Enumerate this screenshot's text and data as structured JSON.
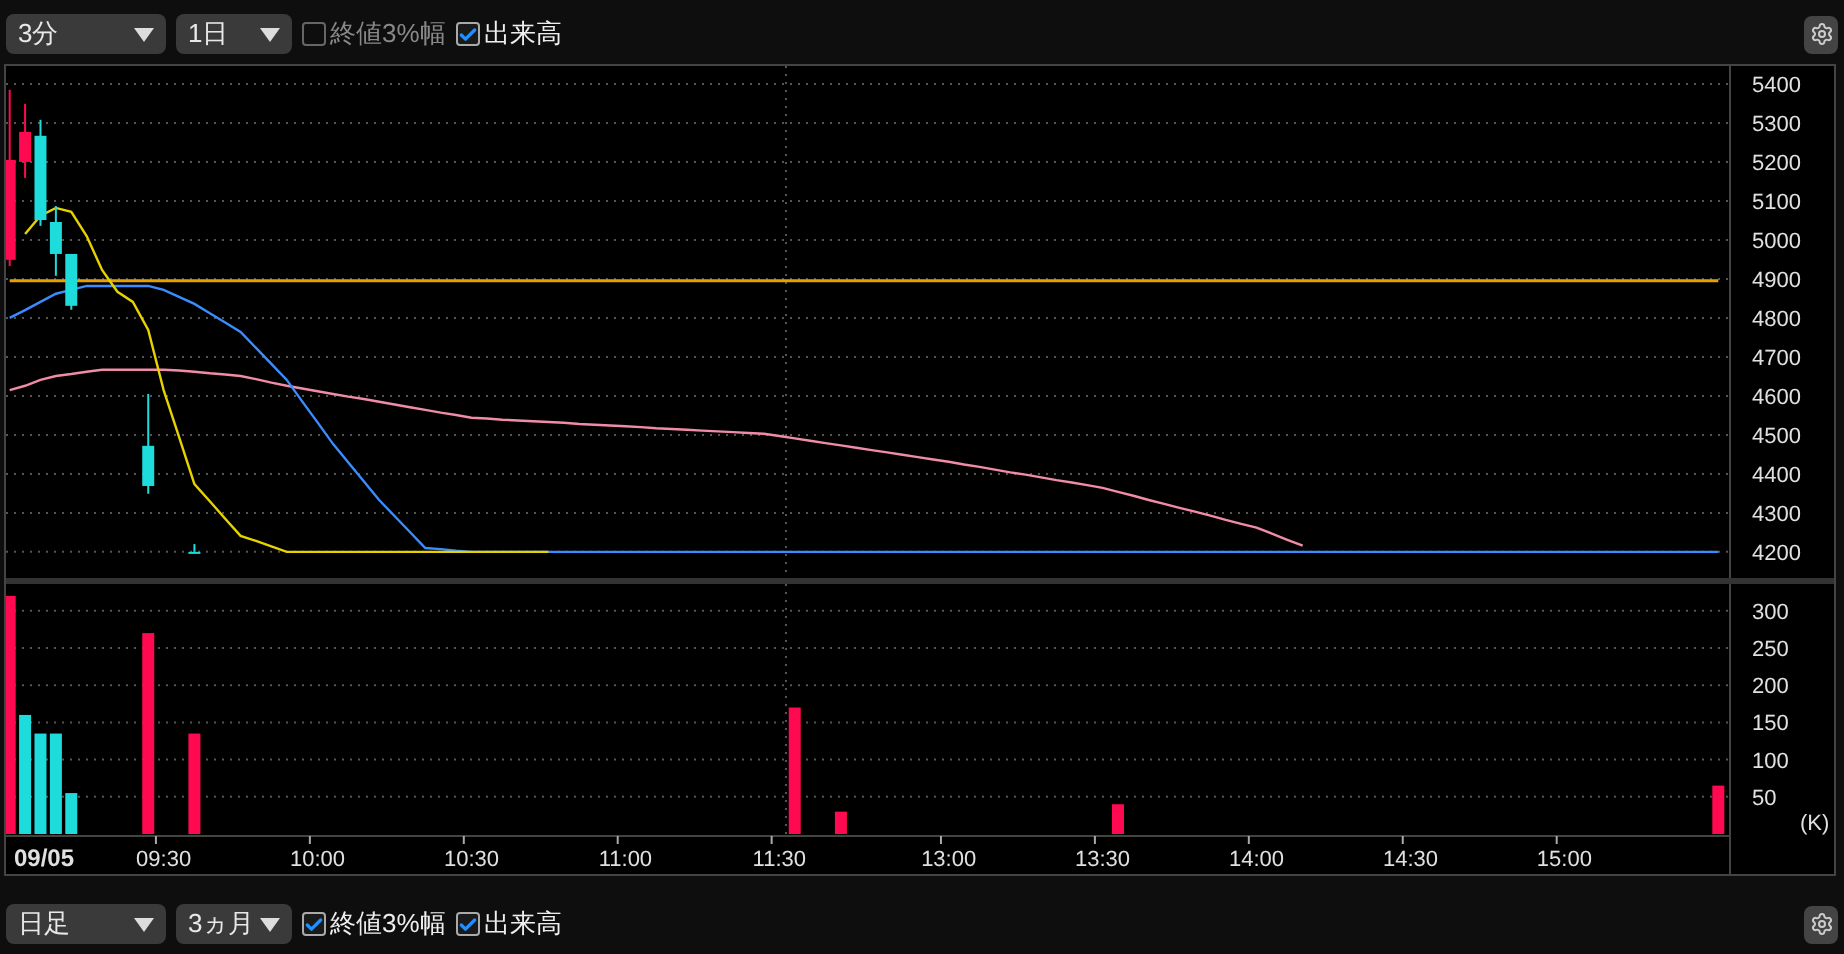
{
  "top_toolbar": {
    "interval_select": {
      "value": "3分"
    },
    "range_select": {
      "value": "1日"
    },
    "checkboxes": [
      {
        "label": "終値3%幅",
        "checked": false
      },
      {
        "label": "出来高",
        "checked": true
      }
    ]
  },
  "price_chart": {
    "chart_data": {
      "type": "line",
      "grid": true,
      "ylim": [
        4133,
        5446
      ],
      "yticks": [
        5400,
        5300,
        5200,
        5100,
        5000,
        4900,
        4800,
        4700,
        4600,
        4500,
        4400,
        4300,
        4200
      ],
      "categories": [
        null,
        null,
        null,
        null,
        null,
        null,
        null,
        null,
        null,
        null,
        null,
        null,
        null,
        null,
        null,
        null,
        null,
        null,
        null,
        null,
        null,
        null,
        null,
        null,
        null,
        null,
        null,
        null,
        null,
        null,
        null,
        null,
        null,
        null,
        null,
        null,
        null,
        null,
        null,
        null,
        null,
        null,
        null,
        null,
        null,
        null,
        null,
        null,
        null,
        null,
        null,
        null,
        null,
        null,
        null,
        null,
        null,
        null,
        null,
        null,
        null,
        null,
        null,
        null,
        null,
        null,
        null,
        null,
        null,
        null,
        null,
        null,
        null,
        null,
        null,
        null,
        null,
        null,
        null,
        null,
        null,
        null,
        null,
        null,
        null,
        null,
        null,
        null,
        null,
        null,
        null,
        null,
        null,
        null,
        null,
        null,
        null,
        null,
        null,
        null,
        null,
        null,
        null,
        null,
        null,
        null,
        null,
        null,
        null,
        null,
        null,
        null
      ],
      "series": [
        {
          "color": "#e8a000",
          "values": [
            4895,
            4895,
            4895,
            4895,
            4895,
            4895,
            4895,
            4895,
            4895,
            4895,
            4895,
            4895,
            4895,
            4895,
            4895,
            4895,
            4895,
            4895,
            4895,
            4895,
            4895,
            4895,
            4895,
            4895,
            4895,
            4895,
            4895,
            4895,
            4895,
            4895,
            4895,
            4895,
            4895,
            4895,
            4895,
            4895,
            4895,
            4895,
            4895,
            4895,
            4895,
            4895,
            4895,
            4895,
            4895,
            4895,
            4895,
            4895,
            4895,
            4895,
            4895,
            4895,
            4895,
            4895,
            4895,
            4895,
            4895,
            4895,
            4895,
            4895,
            4895,
            4895,
            4895,
            4895,
            4895,
            4895,
            4895,
            4895,
            4895,
            4895,
            4895,
            4895,
            4895,
            4895,
            4895,
            4895,
            4895,
            4895,
            4895,
            4895,
            4895,
            4895,
            4895,
            4895,
            4895,
            4895,
            4895,
            4895,
            4895,
            4895,
            4895,
            4895,
            4895,
            4895,
            4895,
            4895,
            4895,
            4895,
            4895,
            4895,
            4895,
            4895,
            4895,
            4895,
            4895,
            4895,
            4895,
            4895,
            4895,
            4895,
            4895,
            4895
          ]
        },
        {
          "color": "#f08ca8",
          "values": [
            4615,
            4626,
            4641,
            4651,
            4656,
            4662,
            4667,
            4667,
            4667,
            4667,
            4667,
            4665,
            4662,
            4658,
            4655,
            4651,
            4643,
            4634,
            4626,
            4619,
            4612,
            4605,
            4598,
            4592,
            4585,
            4578,
            4571,
            4564,
            4557,
            4551,
            4544,
            4542,
            4539,
            4537,
            4535,
            4533,
            4531,
            4528,
            4526,
            4524,
            4522,
            4520,
            4517,
            4515,
            4513,
            4511,
            4509,
            4507,
            4505,
            4503,
            4497,
            4491,
            4485,
            4479,
            4473,
            4467,
            4461,
            4455,
            4449,
            4443,
            4437,
            4431,
            4424,
            4418,
            4411,
            4404,
            4398,
            4391,
            4384,
            4378,
            4371,
            4364,
            4354,
            4344,
            4333,
            4323,
            4313,
            4303,
            4293,
            4282,
            4272,
            4262,
            4247,
            4231,
            4216,
            null,
            null,
            null,
            null,
            null,
            null,
            null,
            null,
            null,
            null,
            null,
            null,
            null,
            null,
            null,
            null,
            null,
            null,
            null,
            null,
            null,
            null,
            null,
            null,
            null,
            null,
            null
          ]
        },
        {
          "color": "#3a8cff",
          "values": [
            4800,
            4820,
            4841,
            4862,
            4872,
            4882,
            4882,
            4882,
            4882,
            4882,
            4872,
            4854,
            4836,
            4812,
            4788,
            4764,
            4723,
            4682,
            4641,
            4586,
            4532,
            4477,
            4429,
            4381,
            4333,
            4292,
            4251,
            4210,
            4207,
            4203,
            4200,
            null,
            null,
            null,
            null,
            null,
            4200,
            4200,
            4200,
            4200,
            4200,
            4200,
            4200,
            4200,
            4200,
            4200,
            4200,
            4200,
            4200,
            4200,
            4200,
            4200,
            4200,
            4200,
            4200,
            4200,
            4200,
            4200,
            4200,
            4200,
            4200,
            4200,
            4200,
            4200,
            4200,
            4200,
            4200,
            4200,
            4200,
            4200,
            4200,
            4200,
            4200,
            4200,
            4200,
            4200,
            4200,
            4200,
            4200,
            4200,
            4200,
            4200,
            4200,
            4200,
            4200,
            4200,
            4200,
            4200,
            4200,
            4200,
            4200,
            4200,
            4200,
            4200,
            4200,
            4200,
            4200,
            4200,
            4200,
            4200,
            4200,
            4200,
            4200,
            4200,
            4200,
            4200,
            4200,
            4200,
            4200,
            4200,
            4200,
            4200
          ]
        },
        {
          "color": "#e6d200",
          "values": [
            null,
            5015,
            5062,
            5082,
            5072,
            5010,
            4923,
            4867,
            4841,
            4769,
            4615,
            4495,
            4374,
            4330,
            4285,
            4241,
            4228,
            4214,
            4200,
            4200,
            4200,
            4200,
            4200,
            4200,
            4200,
            4200,
            4200,
            4200,
            4200,
            4200,
            4200,
            4200,
            4200,
            4200,
            4200,
            4200,
            null,
            null,
            null,
            null,
            null,
            null,
            null,
            null,
            null,
            null,
            null,
            null,
            null,
            null,
            null,
            null,
            null,
            null,
            null,
            null,
            null,
            null,
            null,
            null,
            null,
            null,
            null,
            null,
            null,
            null,
            null,
            null,
            null,
            null,
            null,
            null,
            null,
            null,
            null,
            null,
            null,
            null,
            null,
            null,
            null,
            null,
            null,
            null,
            null,
            null,
            null,
            null,
            null,
            null,
            null,
            null,
            null,
            null,
            null,
            null,
            null,
            null,
            null,
            null,
            null,
            null,
            null,
            null,
            null,
            null,
            null,
            null,
            null,
            null,
            null,
            null
          ]
        }
      ]
    }
  },
  "volume_chart": {
    "date_label": "09/05",
    "unit": "(K)",
    "chart_data": {
      "type": "bar",
      "grid": true,
      "ylim": [
        0,
        336
      ],
      "categories": [
        null,
        null,
        null,
        null,
        null,
        null,
        null,
        null,
        null,
        null,
        "09:30",
        null,
        null,
        null,
        null,
        null,
        null,
        null,
        null,
        null,
        "10:00",
        null,
        null,
        null,
        null,
        null,
        null,
        null,
        null,
        null,
        "10:30",
        null,
        null,
        null,
        null,
        null,
        null,
        null,
        null,
        null,
        "11:00",
        null,
        null,
        null,
        null,
        null,
        null,
        null,
        null,
        null,
        "11:30",
        null,
        null,
        null,
        null,
        null,
        null,
        null,
        null,
        null,
        null,
        "13:00",
        null,
        null,
        null,
        null,
        null,
        null,
        null,
        null,
        null,
        "13:30",
        null,
        null,
        null,
        null,
        null,
        null,
        null,
        null,
        null,
        "14:00",
        null,
        null,
        null,
        null,
        null,
        null,
        null,
        null,
        null,
        "14:30",
        null,
        null,
        null,
        null,
        null,
        null,
        null,
        null,
        null,
        "15:00",
        null,
        null,
        null,
        null,
        null,
        null,
        null,
        null,
        null,
        null
      ],
      "series": [
        {
          "color": "#ff0a50",
          "values": [
            320,
            null,
            null,
            null,
            null,
            null,
            null,
            null,
            null,
            270,
            null,
            null,
            135,
            null,
            null,
            null,
            null,
            null,
            null,
            null,
            null,
            null,
            null,
            null,
            null,
            null,
            null,
            null,
            null,
            null,
            null,
            null,
            null,
            null,
            null,
            null,
            null,
            null,
            null,
            null,
            null,
            null,
            null,
            null,
            null,
            null,
            null,
            null,
            null,
            null,
            null,
            170,
            null,
            null,
            30,
            null,
            null,
            null,
            null,
            null,
            null,
            null,
            null,
            null,
            null,
            null,
            null,
            null,
            null,
            null,
            null,
            null,
            40,
            null,
            null,
            null,
            null,
            null,
            null,
            null,
            null,
            null,
            null,
            null,
            null,
            null,
            null,
            null,
            null,
            null,
            null,
            null,
            null,
            null,
            null,
            null,
            null,
            null,
            null,
            null,
            null,
            null,
            null,
            null,
            null,
            null,
            null,
            null,
            null,
            null,
            null,
            65
          ]
        },
        {
          "color": "#1edcdc",
          "values": [
            null,
            160,
            135,
            135,
            55,
            null,
            null,
            null,
            null,
            null,
            null,
            null,
            null,
            null,
            null,
            null,
            null,
            null,
            null,
            null,
            null,
            null,
            null,
            null,
            null,
            null,
            null,
            null,
            null,
            null,
            null,
            null,
            null,
            null,
            null,
            null,
            null,
            null,
            null,
            null,
            null,
            null,
            null,
            null,
            null,
            null,
            null,
            null,
            null,
            null,
            null,
            null,
            null,
            null,
            null,
            null,
            null,
            null,
            null,
            null,
            null,
            null,
            null,
            null,
            null,
            null,
            null,
            null,
            null,
            null,
            null,
            null,
            null,
            null,
            null,
            null,
            null,
            null,
            null,
            null,
            null,
            null,
            null,
            null,
            null,
            null,
            null,
            null,
            null,
            null,
            null,
            null,
            null,
            null,
            null,
            null,
            null,
            null,
            null,
            null,
            null,
            null,
            null,
            null,
            null,
            null,
            null,
            null,
            null,
            null,
            null,
            null
          ]
        }
      ],
      "yticks": [
        50,
        100,
        150,
        200,
        250,
        300
      ]
    }
  },
  "bottom_toolbar": {
    "interval_select": {
      "value": "日足"
    },
    "range_select": {
      "value": "3ヵ月"
    },
    "checkboxes": [
      {
        "label": "終値3%幅",
        "checked": true
      },
      {
        "label": "出来高",
        "checked": true
      }
    ]
  }
}
